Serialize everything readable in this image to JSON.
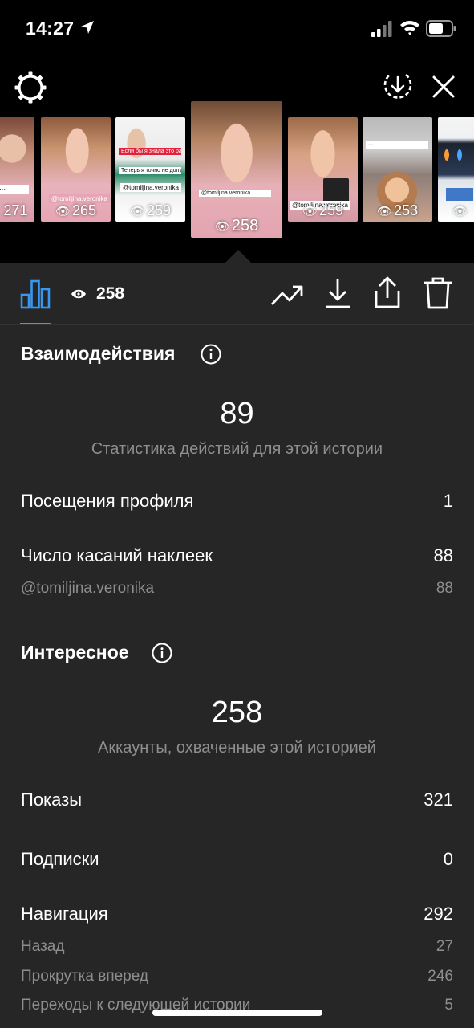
{
  "status_bar": {
    "time": "14:27"
  },
  "stories": [
    {
      "views": "271",
      "text": "",
      "accent": "#d9a9b3"
    },
    {
      "views": "265",
      "text": "@tomiljina.veronika",
      "accent": "#e6b7bf"
    },
    {
      "views": "259",
      "text": "@tomiljina.veronika",
      "accent": "#f3f3f3"
    },
    {
      "views": "258",
      "text": "",
      "accent": "#e3b1b8",
      "selected": true
    },
    {
      "views": "259",
      "text": "@tomiljina.veronika",
      "accent": "#d7a8ae"
    },
    {
      "views": "253",
      "text": "",
      "accent": "#b99b8a"
    },
    {
      "views": "",
      "text": "",
      "accent": "#dfe4ea"
    }
  ],
  "thumb_texts": {
    "t3_a": "Если бы я знала это раньше, многого бы не произошло",
    "t3_b": "Теперь я точно не допущу таких ошибок",
    "t3_c": "@tomiljina.veronika"
  },
  "toolbar": {
    "views": "258"
  },
  "interactions": {
    "title": "Взаимодействия",
    "total": "89",
    "caption": "Статистика действий для этой истории",
    "rows": [
      {
        "label": "Посещения профиля",
        "value": "1"
      },
      {
        "label": "Число касаний наклеек",
        "value": "88"
      }
    ],
    "sub_rows": [
      {
        "label": "@tomiljina.veronika",
        "value": "88"
      }
    ]
  },
  "discovery": {
    "title": "Интересное",
    "total": "258",
    "caption": "Аккаунты, охваченные этой историей",
    "rows": [
      {
        "label": "Показы",
        "value": "321"
      },
      {
        "label": "Подписки",
        "value": "0"
      },
      {
        "label": "Навигация",
        "value": "292"
      }
    ],
    "sub_rows": [
      {
        "label": "Назад",
        "value": "27"
      },
      {
        "label": "Прокрутка вперед",
        "value": "246"
      },
      {
        "label": "Переходы к следующей истории",
        "value": "5"
      }
    ]
  },
  "colors": {
    "background": "#262626",
    "accent": "#3897f0",
    "muted": "#8e8e8e"
  }
}
